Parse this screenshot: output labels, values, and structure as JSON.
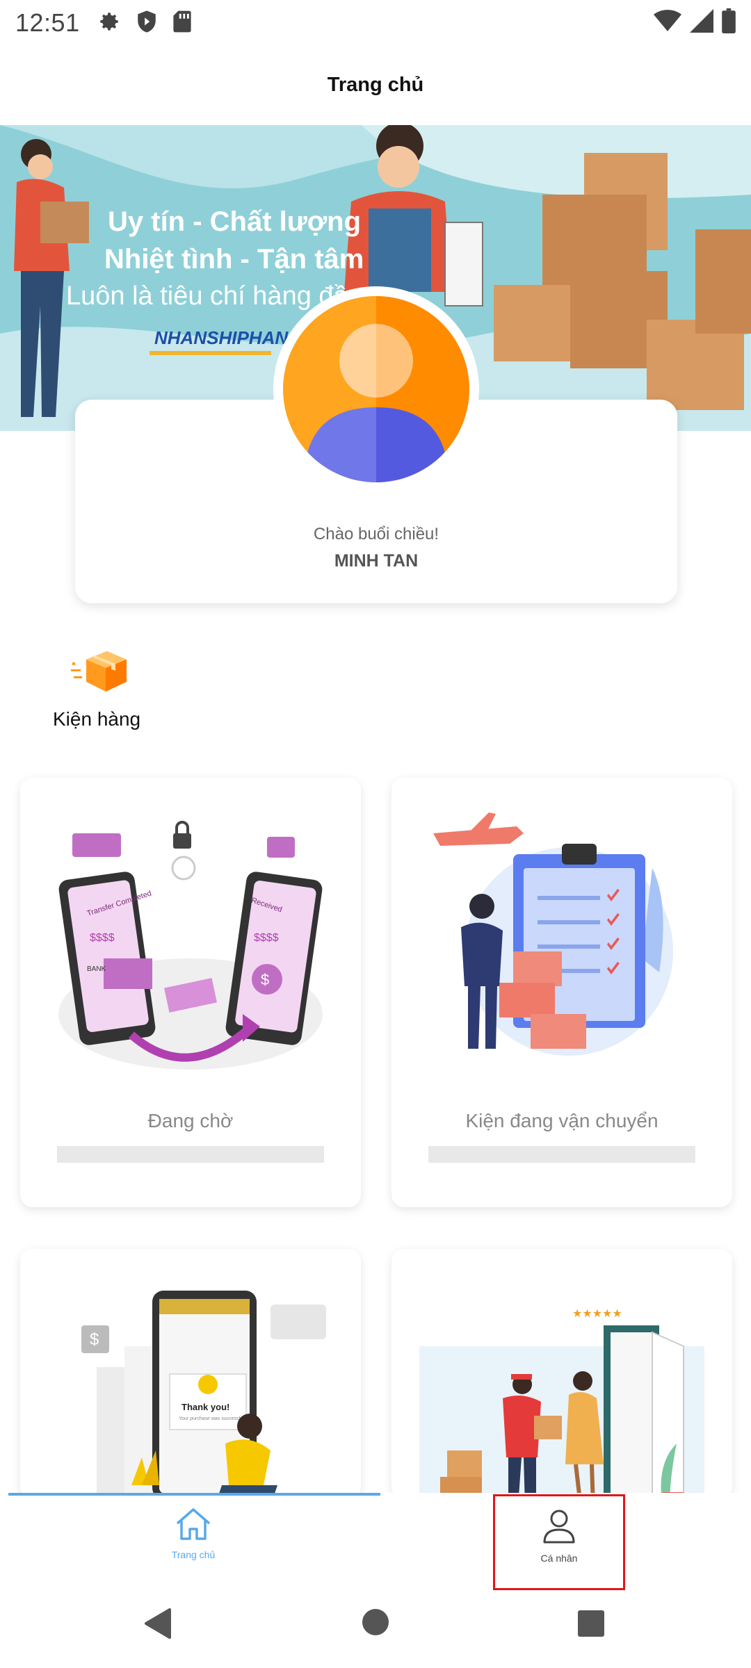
{
  "status_bar": {
    "time": "12:51",
    "left_icons": [
      "gear-icon",
      "shield-icon",
      "sd-card-icon"
    ],
    "right_icons": [
      "wifi-icon",
      "signal-icon",
      "battery-icon"
    ]
  },
  "header": {
    "title": "Trang chủ"
  },
  "banner": {
    "line1": "Uy tín - Chất lượng",
    "line2": "Nhiệt tình - Tận tâm",
    "line3": "Luôn là tiêu chí hàng đầu t",
    "brand": "NHANSHIPHANG"
  },
  "profile": {
    "greeting": "Chào buổi chiều!",
    "name": "MINH TAN"
  },
  "section": {
    "label": "Kiện hàng",
    "icon": "package-icon"
  },
  "cards": [
    {
      "title": "Đang chờ",
      "illustration": "money-transfer-illustration"
    },
    {
      "title": "Kiện đang vận chuyển",
      "illustration": "shipping-checklist-illustration"
    },
    {
      "title": "",
      "illustration": "payment-success-illustration"
    },
    {
      "title": "",
      "illustration": "delivery-door-illustration"
    }
  ],
  "card_illustration_text": {
    "transfer_completed": "Transfer Completed",
    "received": "Received",
    "amount": "$$$$",
    "bank": "BANK",
    "thank_you": "Thank you!",
    "thank_you_sub": "Your purchase was successful"
  },
  "bottom_nav": {
    "home_label": "Trang chủ",
    "profile_label": "Cá nhân"
  },
  "colors": {
    "accent": "#5aa9e6",
    "highlight_border": "#e0161b",
    "avatar_orange": "#ff9a1f",
    "avatar_blue": "#5b63e0"
  }
}
